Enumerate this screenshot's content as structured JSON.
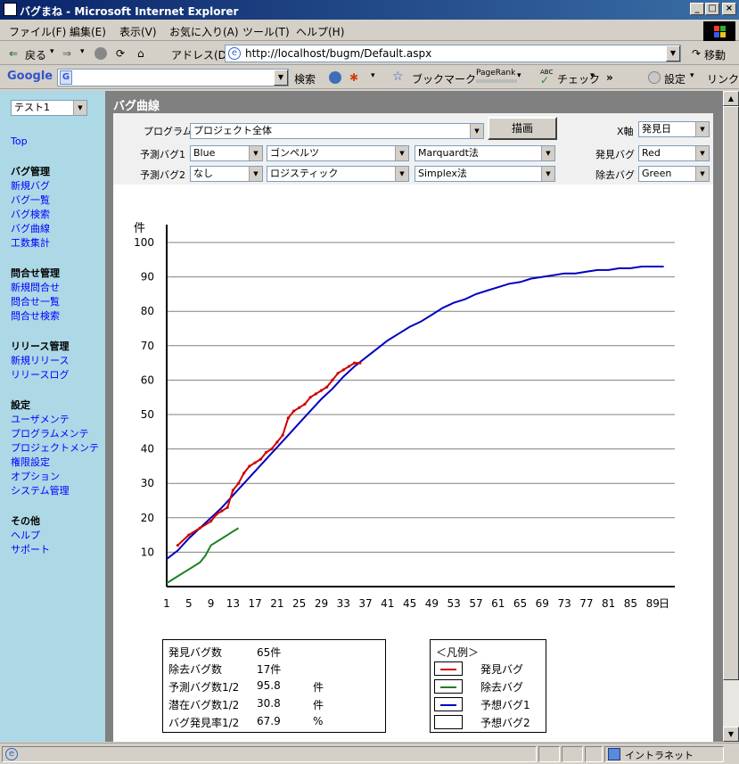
{
  "window": {
    "title": "バグまね - Microsoft Internet Explorer",
    "min": "_",
    "max": "□",
    "close": "×"
  },
  "menu": [
    "ファイル(F)",
    "編集(E)",
    "表示(V)",
    "お気に入り(A)",
    "ツール(T)",
    "ヘルプ(H)"
  ],
  "toolbar": {
    "back": "戻る",
    "address_label": "アドレス(D)",
    "url": "http://localhost/bugm/Default.aspx",
    "go": "移動"
  },
  "googlebar": {
    "logo": "Google",
    "g_icon": "G",
    "search": "検索",
    "bookmark": "ブックマーク",
    "pagerank": "PageRank",
    "abc": "ABC",
    "check": "チェック",
    "more": "»",
    "settings": "設定",
    "link": "リンク"
  },
  "sidebar": {
    "project_select": "テスト1",
    "top": "Top",
    "groups": [
      {
        "title": "バグ管理",
        "items": [
          "新規バグ",
          "バグ一覧",
          "バグ検索",
          "バグ曲線",
          "工数集計"
        ]
      },
      {
        "title": "問合せ管理",
        "items": [
          "新規問合せ",
          "問合せ一覧",
          "問合せ検索"
        ]
      },
      {
        "title": "リリース管理",
        "items": [
          "新規リリース",
          "リリースログ"
        ]
      },
      {
        "title": "設定",
        "items": [
          "ユーザメンテ",
          "プログラムメンテ",
          "プロジェクトメンテ",
          "権限設定",
          "オプション",
          "システム管理"
        ]
      },
      {
        "title": "その他",
        "items": [
          "ヘルプ",
          "サポート"
        ]
      }
    ]
  },
  "page": {
    "title": "バグ曲線",
    "program_label": "プログラム",
    "program_value": "プロジェクト全体",
    "draw_button": "描画",
    "xaxis_label": "X軸",
    "xaxis_value": "発見日",
    "pred1_label": "予測バグ1",
    "pred1_color": "Blue",
    "pred1_model": "ゴンペルツ",
    "pred1_method": "Marquardt法",
    "pred2_label": "予測バグ2",
    "pred2_color": "なし",
    "pred2_model": "ロジスティック",
    "pred2_method": "Simplex法",
    "found_label": "発見バグ",
    "found_color": "Red",
    "removed_label": "除去バグ",
    "removed_color": "Green"
  },
  "chart_data": {
    "type": "line",
    "ylabel": "件",
    "xlabel": "日",
    "ylim": [
      0,
      100
    ],
    "xlim": [
      1,
      93
    ],
    "yticks": [
      10,
      20,
      30,
      40,
      50,
      60,
      70,
      80,
      90,
      100
    ],
    "xticks": [
      1,
      5,
      9,
      13,
      17,
      21,
      25,
      29,
      33,
      37,
      41,
      45,
      49,
      53,
      57,
      61,
      65,
      69,
      73,
      77,
      81,
      85,
      89
    ],
    "grid": true,
    "series": [
      {
        "name": "予想バグ1",
        "color": "#0000c0",
        "x": [
          1,
          3,
          5,
          7,
          9,
          11,
          13,
          15,
          17,
          19,
          21,
          23,
          25,
          27,
          29,
          31,
          33,
          35,
          37,
          39,
          41,
          43,
          45,
          47,
          49,
          51,
          53,
          55,
          57,
          59,
          61,
          63,
          65,
          67,
          69,
          71,
          73,
          75,
          77,
          79,
          81,
          83,
          85,
          87,
          89,
          91
        ],
        "y": [
          8,
          10.5,
          14,
          17,
          20,
          23,
          26.5,
          30,
          33.5,
          37,
          40.5,
          44,
          47.5,
          51,
          54.5,
          57.5,
          61,
          64,
          66.5,
          69,
          71.5,
          73.5,
          75.5,
          77,
          79,
          81,
          82.5,
          83.5,
          85,
          86,
          87,
          88,
          88.5,
          89.5,
          90,
          90.5,
          91,
          91,
          91.5,
          92,
          92,
          92.5,
          92.5,
          93,
          93,
          93
        ]
      },
      {
        "name": "発見バグ",
        "color": "#d00000",
        "x": [
          3,
          5,
          7,
          9,
          10,
          11,
          12,
          13,
          14,
          15,
          16,
          17,
          18,
          19,
          20,
          21,
          22,
          23,
          24,
          25,
          26,
          27,
          28,
          29,
          30,
          31,
          32,
          33,
          34,
          35,
          36
        ],
        "y": [
          12,
          15,
          17,
          19,
          21,
          22,
          23,
          28,
          30,
          33,
          35,
          36,
          37,
          39,
          40,
          42,
          44,
          49,
          51,
          52,
          53,
          55,
          56,
          57,
          58,
          60,
          62,
          63,
          64,
          65,
          65
        ]
      },
      {
        "name": "除去バグ",
        "color": "#208020",
        "x": [
          1,
          3,
          5,
          7,
          8,
          9,
          11,
          13,
          14
        ],
        "y": [
          1,
          3,
          5,
          7,
          9,
          12,
          14,
          16,
          17
        ]
      }
    ]
  },
  "stats": {
    "found_label": "発見バグ数",
    "found_value": "65件",
    "removed_label": "除去バグ数",
    "removed_value": "17件",
    "pred_label": "予測バグ数1/2",
    "pred_value": "95.8",
    "pred_unit": "件",
    "latent_label": "潜在バグ数1/2",
    "latent_value": "30.8",
    "latent_unit": "件",
    "rate_label": "バグ発見率1/2",
    "rate_value": "67.9",
    "rate_unit": "%"
  },
  "legend": {
    "title": "＜凡例＞",
    "items": [
      {
        "label": "発見バグ",
        "color": "#d00000"
      },
      {
        "label": "除去バグ",
        "color": "#208020"
      },
      {
        "label": "予想バグ1",
        "color": "#0000c0"
      },
      {
        "label": "予想バグ2",
        "color": ""
      }
    ]
  },
  "status": {
    "zone": "イントラネット"
  }
}
